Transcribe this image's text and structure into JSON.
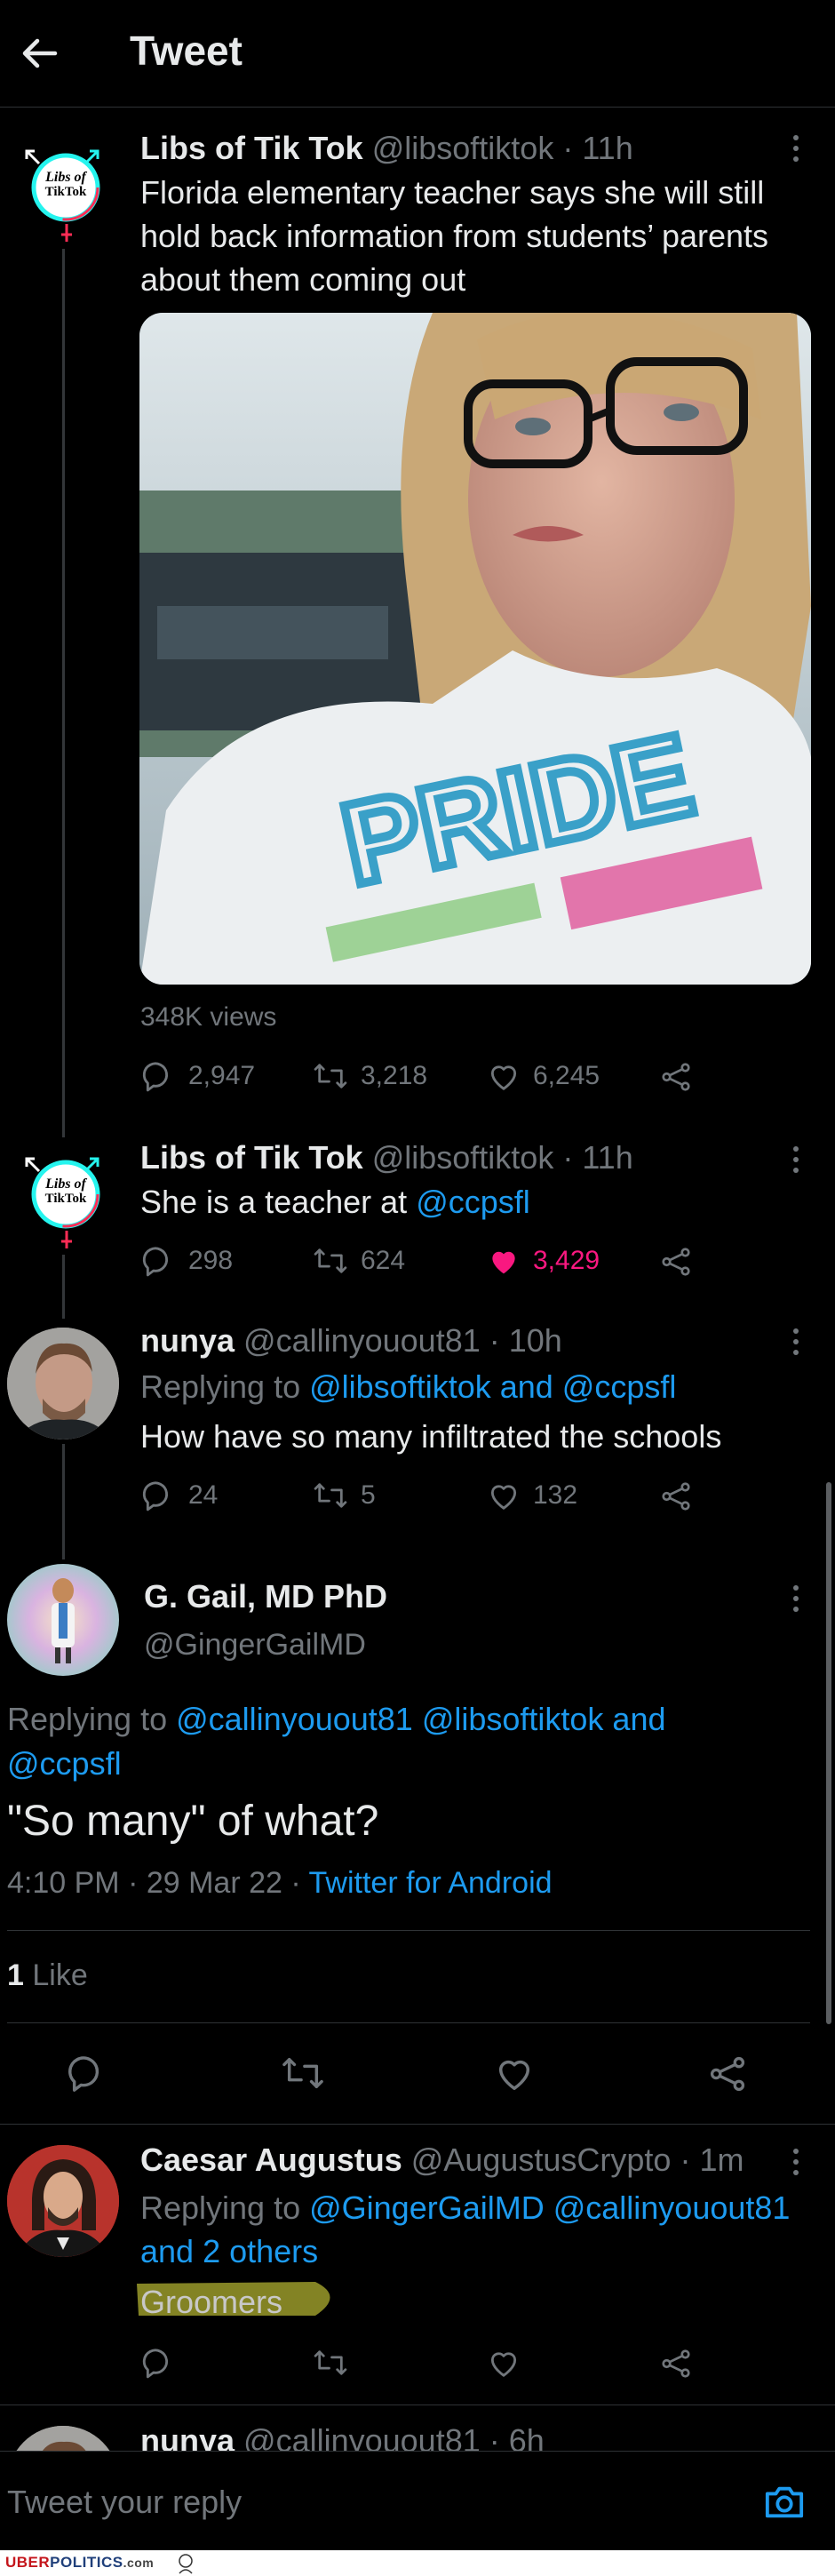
{
  "header": {
    "title": "Tweet"
  },
  "tweet1": {
    "name": "Libs of Tik Tok",
    "handle": "@libsoftiktok",
    "time": "· 11h",
    "text": "Florida elementary teacher says she will still hold back information from students’ parents about them coming out",
    "media_text": "PRIDE",
    "views": "348K views",
    "replies": "2,947",
    "retweets": "3,218",
    "likes": "6,245",
    "avatar_text1": "Libs of",
    "avatar_text2": "TikTok"
  },
  "tweet2": {
    "name": "Libs of Tik Tok",
    "handle": "@libsoftiktok",
    "time": "· 11h",
    "text_prefix": "She is a teacher at ",
    "mention": "@ccpsfl",
    "replies": "298",
    "retweets": "624",
    "likes": "3,429",
    "avatar_text1": "Libs of",
    "avatar_text2": "TikTok"
  },
  "tweet3": {
    "name": "nunya",
    "handle": "@callinyouout81",
    "time": "· 10h",
    "replying_prefix": "Replying to ",
    "replying_to": "@libsoftiktok and @ccpsfl",
    "text": "How have so many infiltrated the schools",
    "replies": "24",
    "retweets": "5",
    "likes": "132"
  },
  "main_tweet": {
    "name": "G. Gail, MD PhD",
    "handle": "@GingerGailMD",
    "replying_prefix": "Replying to ",
    "replying_to_line1": "@callinyouout81 @libsoftiktok and",
    "replying_to_line2": "@ccpsfl",
    "text": "\"So many\" of what?",
    "time": "4:10 PM · 29 Mar 22 · ",
    "source": "Twitter for Android",
    "like_count": "1",
    "like_label": " Like"
  },
  "reply1": {
    "name": "Caesar Augustus",
    "handle": "@AugustusCrypto",
    "time": "· 1m",
    "replying_prefix": "Replying to ",
    "replying_to_line1": "@GingerGailMD @callinyouout81",
    "replying_to_line2": "and 2 others",
    "text": "Groomers"
  },
  "reply2": {
    "name": "nunya",
    "handle": "@callinyouout81",
    "time": "· 6h"
  },
  "compose": {
    "placeholder": "Tweet your reply"
  },
  "footer": {
    "brand_uber": "UBER",
    "brand_politics": "POLITICS",
    "brand_domain": ".com"
  },
  "colors": {
    "background": "#000000",
    "link": "#1d9bf0",
    "like_active": "#f91880",
    "muted": "#71767b",
    "highlight": "#9a9a2a"
  }
}
